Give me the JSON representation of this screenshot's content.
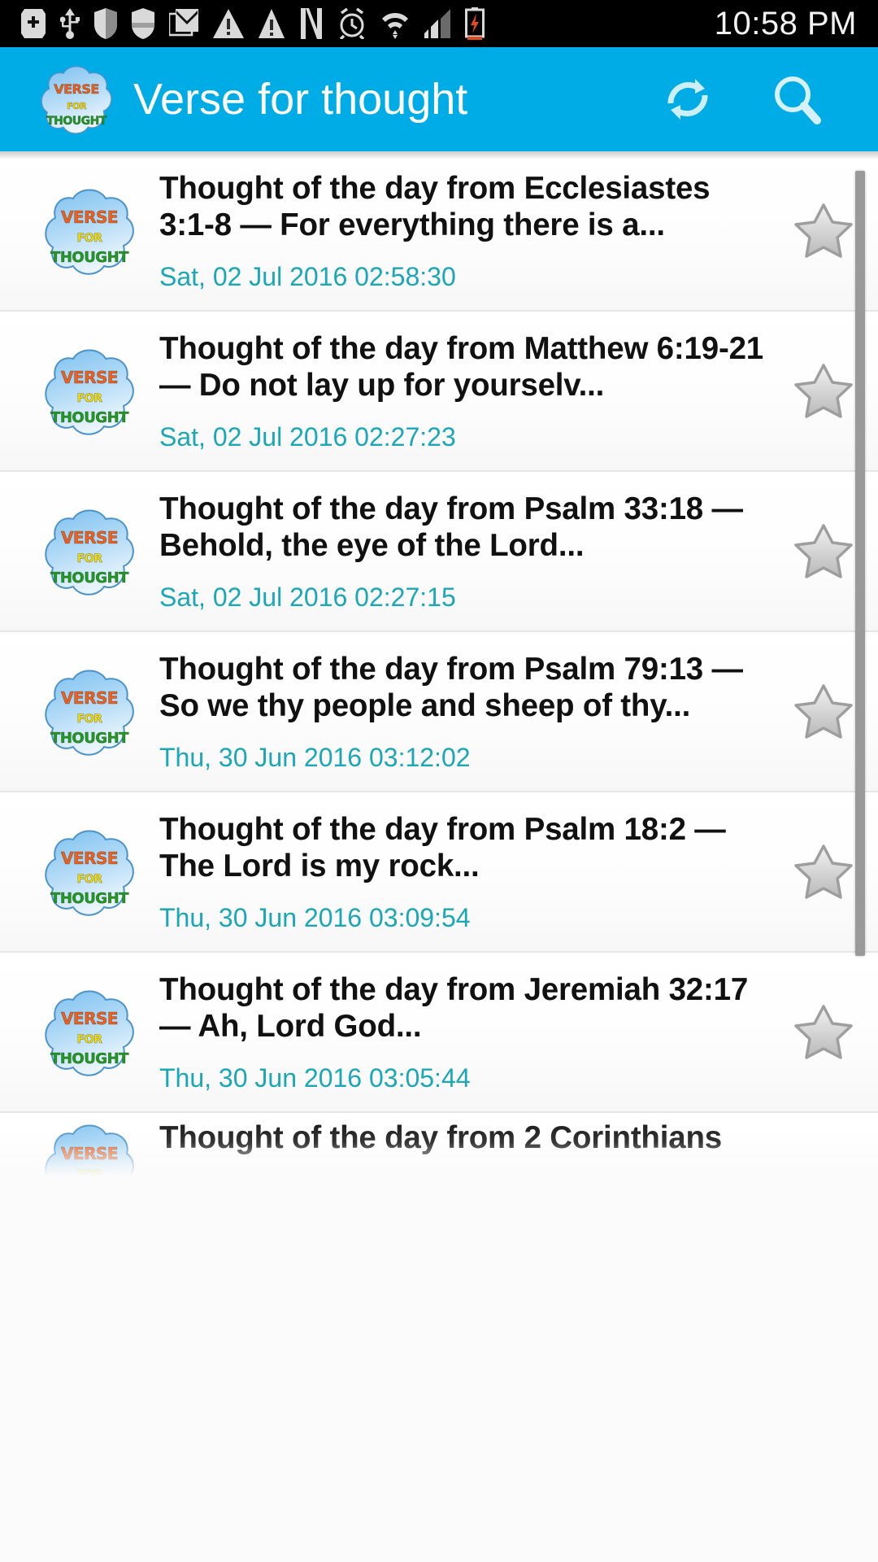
{
  "status_bar": {
    "time": "10:58 PM",
    "icons": [
      "app-plus-icon",
      "usb-icon",
      "shield-icon",
      "shield-alt-icon",
      "gmail-icon",
      "warning-icon",
      "warning-alt-icon",
      "nfc-icon",
      "alarm-icon",
      "wifi-icon",
      "signal-icon",
      "battery-charging-icon"
    ]
  },
  "app_bar": {
    "title": "Verse for thought",
    "logo": {
      "line1": "VERSE",
      "line2": "FOR",
      "line3": "THOUGHT",
      "color1": "#f2601a",
      "color2": "#ffe400",
      "color3": "#1f9c1f"
    },
    "actions": [
      {
        "name": "refresh-button",
        "icon": "refresh-icon"
      },
      {
        "name": "search-button",
        "icon": "search-icon"
      }
    ],
    "background_color": "#00ace6"
  },
  "list": {
    "date_color": "#1aa7b8",
    "star_label": "favorite-star",
    "items": [
      {
        "title": "Thought of the day from Ecclesiastes 3:1-8 — For everything there is a...",
        "date": "Sat, 02 Jul 2016 02:58:30",
        "starred": false
      },
      {
        "title": "Thought of the day from Matthew 6:19-21 — Do not lay up for yourselv...",
        "date": "Sat, 02 Jul 2016 02:27:23",
        "starred": false
      },
      {
        "title": "Thought of the day from Psalm 33:18 — Behold, the eye of the Lord...",
        "date": "Sat, 02 Jul 2016 02:27:15",
        "starred": false
      },
      {
        "title": "Thought of the day from Psalm 79:13 — So we thy people and sheep of thy...",
        "date": "Thu, 30 Jun 2016 03:12:02",
        "starred": false
      },
      {
        "title": "Thought of the day from Psalm 18:2 — The Lord is my rock...",
        "date": "Thu, 30 Jun 2016 03:09:54",
        "starred": false
      },
      {
        "title": "Thought of the day from Jeremiah 32:17 — Ah, Lord God...",
        "date": "Thu, 30 Jun 2016 03:05:44",
        "starred": false
      },
      {
        "title": "Thought of the day from 2 Corinthians",
        "date": "",
        "starred": false,
        "partial": true
      }
    ]
  }
}
